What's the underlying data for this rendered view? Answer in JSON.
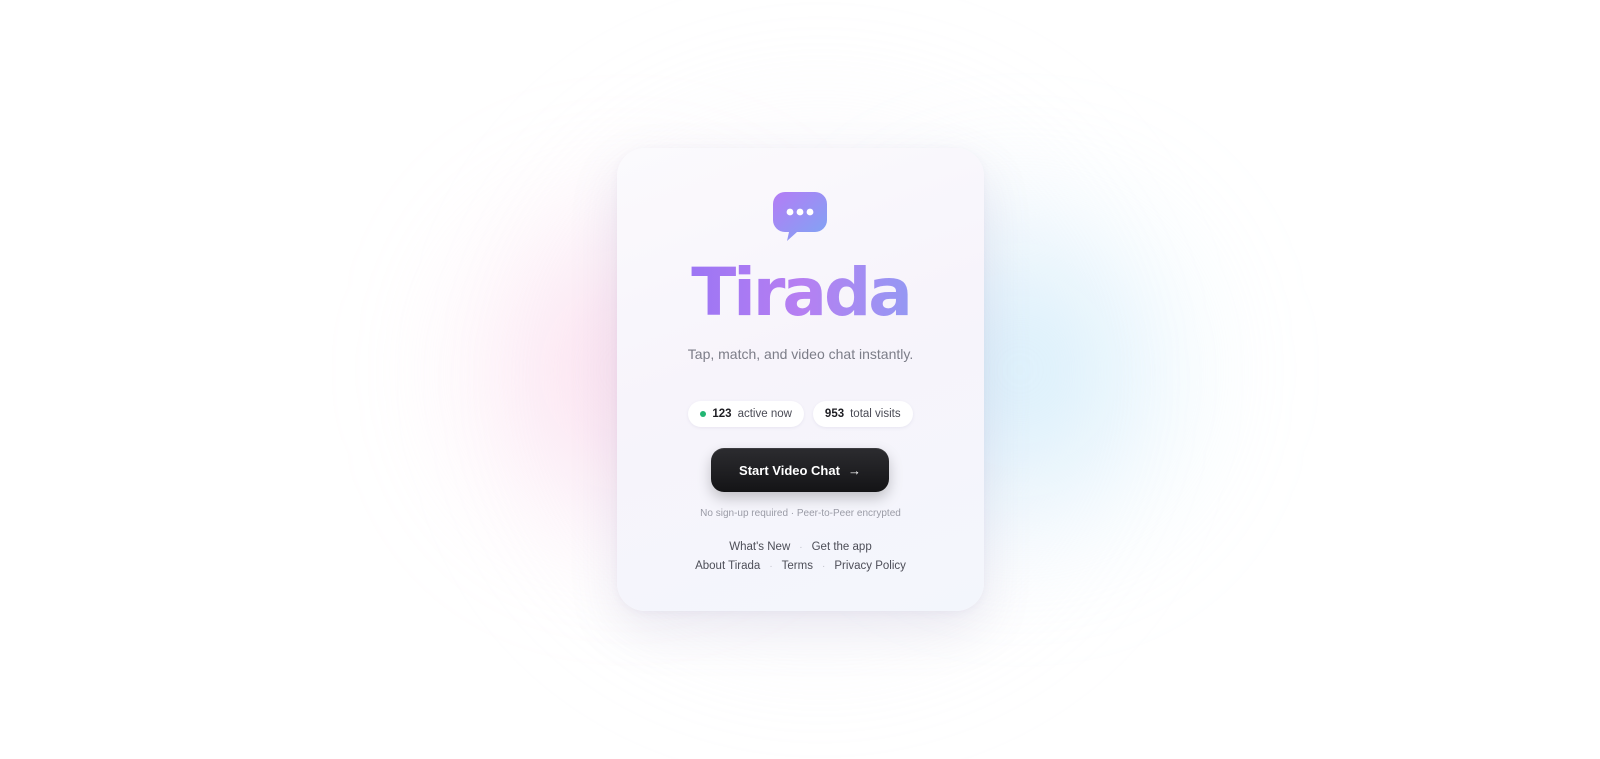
{
  "app": {
    "name": "Tirada",
    "tagline": "Tap, match, and video chat instantly.",
    "logo_icon": "chat-bubble-icon",
    "brand_gradient": [
      "#8b6ff5",
      "#b67ff2",
      "#7ea9f4"
    ]
  },
  "stats": {
    "active": {
      "count": "123",
      "label": "active now",
      "indicator_color": "#22b573"
    },
    "visits": {
      "count": "953",
      "label": "total visits"
    }
  },
  "cta": {
    "label": "Start Video Chat",
    "icon": "arrow-right-icon",
    "background": "#1c1c1f"
  },
  "note": "No sign-up required · Peer-to-Peer encrypted",
  "footer": {
    "row1": [
      "What's New",
      "Get the app"
    ],
    "row2": [
      "About Tirada",
      "Terms",
      "Privacy Policy"
    ],
    "separator": "·"
  }
}
